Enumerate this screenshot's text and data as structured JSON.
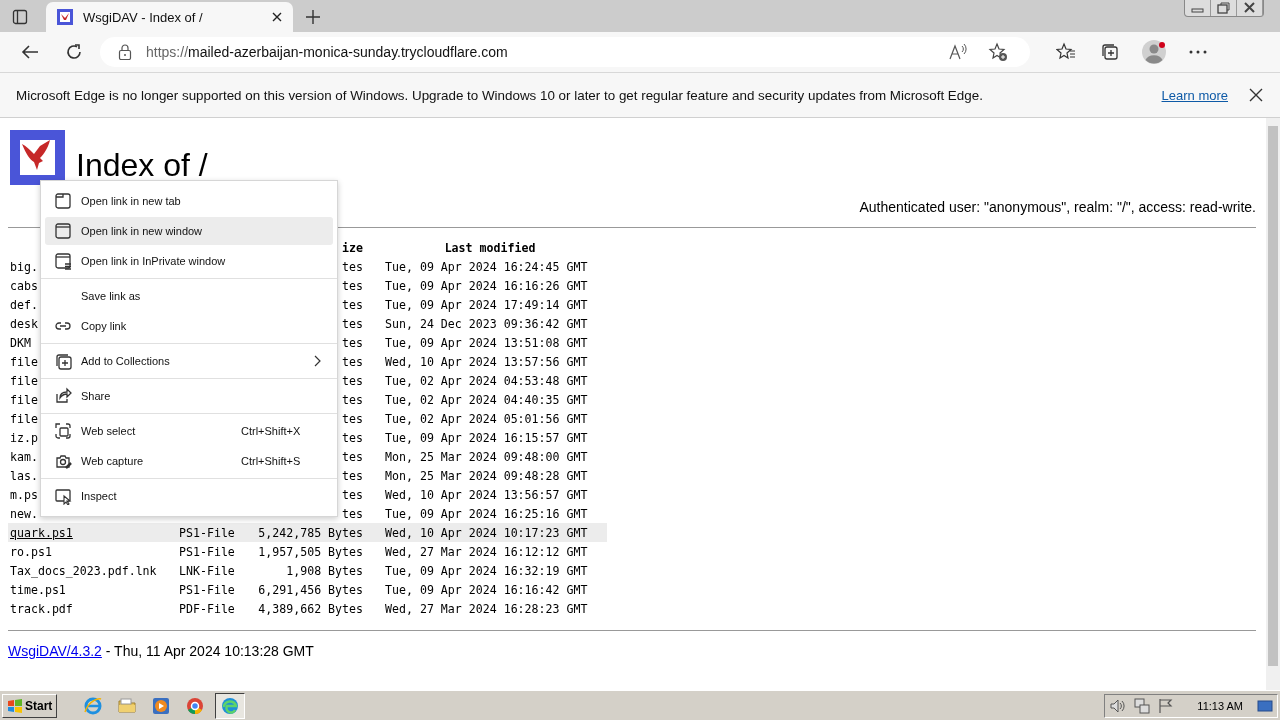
{
  "browser": {
    "tab": {
      "title": "WsgiDAV - Index of /"
    },
    "address": {
      "scheme": "https://",
      "host": "mailed-azerbaijan-monica-sunday.trycloudflare.com"
    }
  },
  "infobar": {
    "message": "Microsoft Edge is no longer supported on this version of Windows. Upgrade to Windows 10 or later to get regular feature and security updates from Microsoft Edge.",
    "link": "Learn more"
  },
  "page": {
    "title": "Index of /",
    "auth": "Authenticated user: \"anonymous\", realm: \"/\", access: read-write.",
    "table": {
      "columns": [
        {
          "label": "ize"
        },
        {
          "label": "Last modified"
        }
      ],
      "rows": [
        {
          "name": "big.",
          "size": "tes",
          "modified": "Tue, 09 Apr 2024 16:24:45 GMT",
          "selected": false
        },
        {
          "name": "cabs",
          "size": "tes",
          "modified": "Tue, 09 Apr 2024 16:16:26 GMT",
          "selected": false
        },
        {
          "name": "def.",
          "size": "tes",
          "modified": "Tue, 09 Apr 2024 17:49:14 GMT",
          "selected": false
        },
        {
          "name": "desk",
          "size": "tes",
          "modified": "Sun, 24 Dec 2023 09:36:42 GMT",
          "selected": false
        },
        {
          "name": "DKM",
          "size": "tes",
          "modified": "Tue, 09 Apr 2024 13:51:08 GMT",
          "selected": false
        },
        {
          "name": "file",
          "size": "tes",
          "modified": "Wed, 10 Apr 2024 13:57:56 GMT",
          "selected": false
        },
        {
          "name": "file",
          "size": "tes",
          "modified": "Tue, 02 Apr 2024 04:53:48 GMT",
          "selected": false
        },
        {
          "name": "file",
          "size": "tes",
          "modified": "Tue, 02 Apr 2024 04:40:35 GMT",
          "selected": false
        },
        {
          "name": "file",
          "size": "tes",
          "modified": "Tue, 02 Apr 2024 05:01:56 GMT",
          "selected": false
        },
        {
          "name": "iz.p",
          "size": "tes",
          "modified": "Tue, 09 Apr 2024 16:15:57 GMT",
          "selected": false
        },
        {
          "name": "kam.",
          "size": "tes",
          "modified": "Mon, 25 Mar 2024 09:48:00 GMT",
          "selected": false
        },
        {
          "name": "las.",
          "size": "tes",
          "modified": "Mon, 25 Mar 2024 09:48:28 GMT",
          "selected": false
        },
        {
          "name": "m.ps",
          "size": "tes",
          "modified": "Wed, 10 Apr 2024 13:56:57 GMT",
          "selected": false
        },
        {
          "name": "new.",
          "size": "tes",
          "modified": "Tue, 09 Apr 2024 16:25:16 GMT",
          "selected": false
        },
        {
          "name": "quark.ps1",
          "type": "PS1-File",
          "size": "5,242,785 Bytes",
          "modified": "Wed, 10 Apr 2024 10:17:23 GMT",
          "selected": true
        },
        {
          "name": "ro.ps1",
          "type": "PS1-File",
          "size": "1,957,505 Bytes",
          "modified": "Wed, 27 Mar 2024 16:12:12 GMT",
          "selected": false
        },
        {
          "name": "Tax_docs_2023.pdf.lnk",
          "type": "LNK-File",
          "size": "1,908 Bytes",
          "modified": "Tue, 09 Apr 2024 16:32:19 GMT",
          "selected": false
        },
        {
          "name": "time.ps1",
          "type": "PS1-File",
          "size": "6,291,456 Bytes",
          "modified": "Tue, 09 Apr 2024 16:16:42 GMT",
          "selected": false
        },
        {
          "name": "track.pdf",
          "type": "PDF-File",
          "size": "4,389,662 Bytes",
          "modified": "Wed, 27 Mar 2024 16:28:23 GMT",
          "selected": false
        }
      ]
    },
    "footer": {
      "link": "WsgiDAV/4.3.2",
      "text": " - Thu, 11 Apr 2024 10:13:28 GMT"
    }
  },
  "context_menu": {
    "items": [
      {
        "kind": "item",
        "label": "Open link in new tab",
        "selected": false
      },
      {
        "kind": "item",
        "label": "Open link in new window",
        "selected": true
      },
      {
        "kind": "item",
        "label": "Open link in InPrivate window",
        "selected": false
      },
      {
        "kind": "separator"
      },
      {
        "kind": "item",
        "label": "Save link as",
        "selected": false
      },
      {
        "kind": "item",
        "label": "Copy link",
        "selected": false
      },
      {
        "kind": "separator"
      },
      {
        "kind": "item",
        "label": "Add to Collections",
        "submenu": true,
        "selected": false
      },
      {
        "kind": "separator"
      },
      {
        "kind": "item",
        "label": "Share",
        "selected": false
      },
      {
        "kind": "separator"
      },
      {
        "kind": "item",
        "label": "Web select",
        "shortcut": "Ctrl+Shift+X",
        "selected": false
      },
      {
        "kind": "item",
        "label": "Web capture",
        "shortcut": "Ctrl+Shift+S",
        "selected": false
      },
      {
        "kind": "separator"
      },
      {
        "kind": "item",
        "label": "Inspect",
        "selected": false
      }
    ]
  },
  "taskbar": {
    "start": "Start",
    "clock": "11:13 AM"
  }
}
